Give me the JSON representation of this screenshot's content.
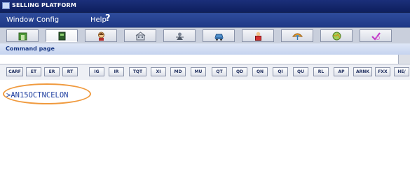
{
  "window": {
    "title": "SELLING PLATFORM"
  },
  "menu": {
    "items": [
      "Window",
      "Config",
      "Help"
    ],
    "help_glyph": "?"
  },
  "toolbar": {
    "tools": [
      {
        "icon": "home-icon",
        "active": false
      },
      {
        "icon": "book-icon",
        "active": true
      },
      {
        "icon": "person-icon",
        "active": false
      },
      {
        "icon": "hotel-icon",
        "active": false
      },
      {
        "icon": "settings-icon",
        "active": false
      },
      {
        "icon": "car-icon",
        "active": false
      },
      {
        "icon": "agent-icon",
        "active": false
      },
      {
        "icon": "umbrella-icon",
        "active": false
      },
      {
        "icon": "globe-icon",
        "active": false
      },
      {
        "icon": "check-icon",
        "active": false
      }
    ]
  },
  "command_page": {
    "title": "Command page"
  },
  "quick_keys": [
    "CARF",
    "ET",
    "ER",
    "RT",
    "IG",
    "IR",
    "TQT",
    "XI",
    "MD",
    "MU",
    "QT",
    "QD",
    "QN",
    "QI",
    "QU",
    "RL",
    "AP",
    "ARNK",
    "FXX",
    "HE/"
  ],
  "terminal": {
    "command": ">AN15OCTNCELON"
  },
  "colors": {
    "titlebar": "#0e1f5e",
    "menubar": "#1e3885",
    "terminal_text": "#1f3fa0",
    "highlight": "#f09a3e"
  }
}
